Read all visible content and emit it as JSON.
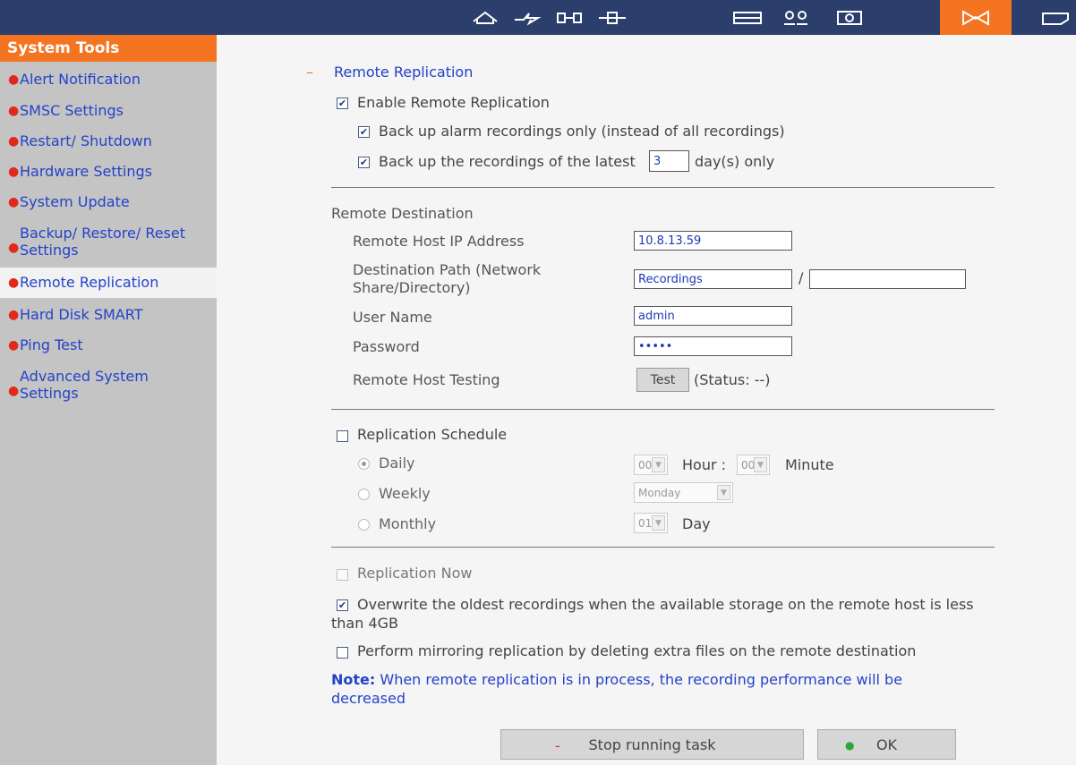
{
  "top_icons": [
    "home-icon",
    "network-icon",
    "device-icon",
    "connection-icon",
    "storage-icon",
    "users-icon",
    "camera-icon",
    "system-tools-icon",
    "folder-icon"
  ],
  "sidebar": {
    "title": "System Tools",
    "items": [
      {
        "label": "Alert Notification"
      },
      {
        "label": "SMSC Settings"
      },
      {
        "label": "Restart/ Shutdown"
      },
      {
        "label": "Hardware Settings"
      },
      {
        "label": "System Update"
      },
      {
        "label": "Backup/ Restore/ Reset Settings"
      },
      {
        "label": "Remote Replication"
      },
      {
        "label": "Hard Disk SMART"
      },
      {
        "label": "Ping Test"
      },
      {
        "label": "Advanced System Settings"
      }
    ]
  },
  "main": {
    "section_title": "Remote Replication",
    "enable_label": "Enable Remote Replication",
    "alarm_only_label": "Back up alarm recordings only (instead of all recordings)",
    "latest_prefix": "Back up the recordings of the latest",
    "latest_value": "3",
    "latest_suffix": "day(s) only",
    "dest_title": "Remote Destination",
    "ip_label": "Remote Host IP Address",
    "ip_value": "10.8.13.59",
    "path_label": "Destination Path (Network Share/Directory)",
    "path_value": "Recordings",
    "path_sep": "/",
    "path_sub_value": "",
    "user_label": "User Name",
    "user_value": "admin",
    "password_label": "Password",
    "password_value": "•••••",
    "testing_label": "Remote Host Testing",
    "test_button": "Test",
    "test_status": "(Status: --)",
    "schedule_label": "Replication Schedule",
    "daily_label": "Daily",
    "weekly_label": "Weekly",
    "monthly_label": "Monthly",
    "hour_value": "00",
    "hour_label": "Hour :",
    "minute_value": "00",
    "minute_label": "Minute",
    "weekday_value": "Monday",
    "day_value": "01",
    "day_label": "Day",
    "replication_now_label": "Replication Now",
    "overwrite_label": "Overwrite the oldest recordings when the available storage on the remote host is less than 4GB",
    "mirror_label": "Perform mirroring replication by deleting extra files on the remote destination",
    "note_bold": "Note:",
    "note_text": "When remote replication is in process, the recording performance will be decreased",
    "stop_button": "Stop running task",
    "ok_button": "OK"
  },
  "colors": {
    "topbar": "#2c3e6b",
    "accent": "#f47421",
    "link": "#2442c9",
    "sidebar_bg": "#c4c4c4"
  }
}
